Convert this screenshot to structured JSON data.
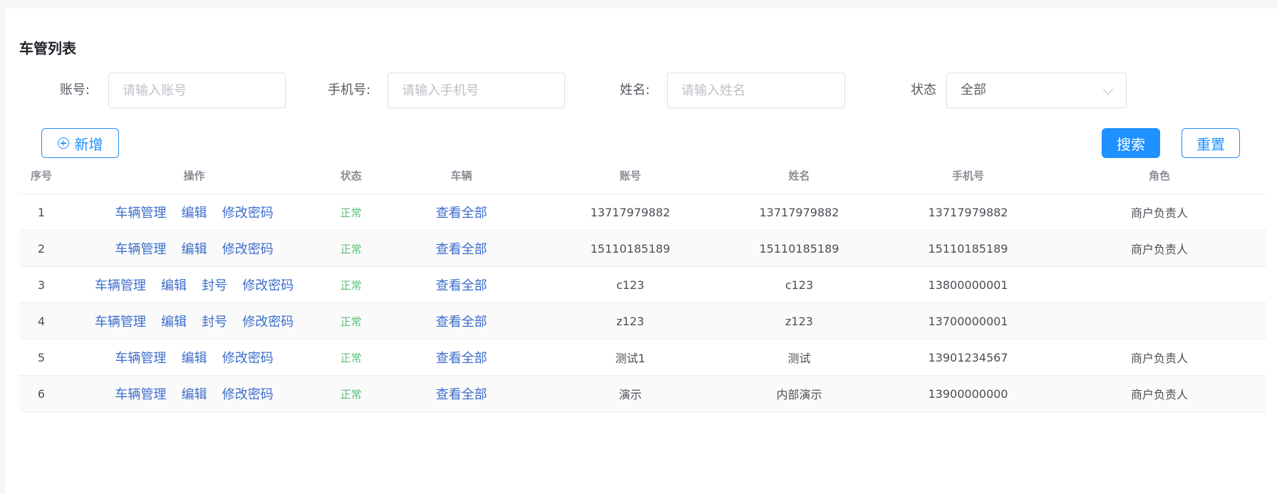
{
  "page_title": "车管列表",
  "filters": {
    "account": {
      "label": "账号:",
      "placeholder": "请输入账号"
    },
    "phone": {
      "label": "手机号:",
      "placeholder": "请输入手机号"
    },
    "name": {
      "label": "姓名:",
      "placeholder": "请输入姓名"
    },
    "status": {
      "label": "状态",
      "value": "全部"
    }
  },
  "buttons": {
    "add": "新增",
    "search": "搜索",
    "reset": "重置"
  },
  "colors": {
    "primary": "#1e90ff",
    "link": "#3d6dcc",
    "status_ok": "#5fbf7a"
  },
  "table": {
    "columns": [
      "序号",
      "操作",
      "状态",
      "车辆",
      "账号",
      "姓名",
      "手机号",
      "角色"
    ],
    "rows": [
      {
        "index": "1",
        "actions": [
          "车辆管理",
          "编辑",
          "修改密码"
        ],
        "status": "正常",
        "vehicle": "查看全部",
        "account": "13717979882",
        "name": "13717979882",
        "phone": "13717979882",
        "role": "商户负责人"
      },
      {
        "index": "2",
        "actions": [
          "车辆管理",
          "编辑",
          "修改密码"
        ],
        "status": "正常",
        "vehicle": "查看全部",
        "account": "15110185189",
        "name": "15110185189",
        "phone": "15110185189",
        "role": "商户负责人"
      },
      {
        "index": "3",
        "actions": [
          "车辆管理",
          "编辑",
          "封号",
          "修改密码"
        ],
        "status": "正常",
        "vehicle": "查看全部",
        "account": "c123",
        "name": "c123",
        "phone": "13800000001",
        "role": ""
      },
      {
        "index": "4",
        "actions": [
          "车辆管理",
          "编辑",
          "封号",
          "修改密码"
        ],
        "status": "正常",
        "vehicle": "查看全部",
        "account": "z123",
        "name": "z123",
        "phone": "13700000001",
        "role": ""
      },
      {
        "index": "5",
        "actions": [
          "车辆管理",
          "编辑",
          "修改密码"
        ],
        "status": "正常",
        "vehicle": "查看全部",
        "account": "测试1",
        "name": "测试",
        "phone": "13901234567",
        "role": "商户负责人"
      },
      {
        "index": "6",
        "actions": [
          "车辆管理",
          "编辑",
          "修改密码"
        ],
        "status": "正常",
        "vehicle": "查看全部",
        "account": "演示",
        "name": "内部演示",
        "phone": "13900000000",
        "role": "商户负责人"
      }
    ]
  }
}
